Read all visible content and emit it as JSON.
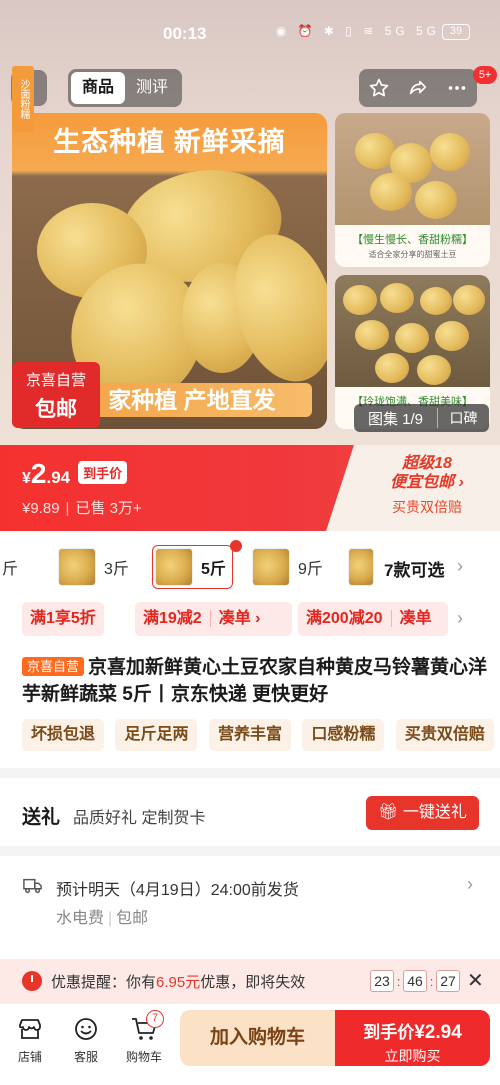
{
  "status_bar": {
    "time": "00:13",
    "icons": "◉ ⏰ ✱ ▯ ≋ 5G 5G",
    "battery": "39"
  },
  "top_nav": {
    "tabs": [
      {
        "label": "商品",
        "active": true
      },
      {
        "label": "测评",
        "active": false
      }
    ],
    "message_badge": "5+"
  },
  "gallery": {
    "main_headline": "生态种植 新鲜采摘",
    "side_tag": "沙面粉糯",
    "main_bottom_text": "家种植 产地直发",
    "jd_tag_line1": "京喜自营",
    "jd_tag_line2": "包邮",
    "thumb1_caption": "【慢生慢长、香甜粉糯】",
    "thumb1_sub": "适合全家分享的甜蜜土豆",
    "thumb2_caption": "【玲珑饱满、香甜美味】",
    "counter": "图集 1/9",
    "review_label": "口碑"
  },
  "price": {
    "currency": "¥",
    "integer": "2",
    "decimal": ".94",
    "label": "到手价",
    "original": "¥9.89",
    "sold": "已售 3万+",
    "promo_line1": "超级18",
    "promo_line2": "便宜包邮 ›",
    "promo_line3": "买贵双倍赔"
  },
  "sku": {
    "options": [
      {
        "label": "斤"
      },
      {
        "label": "3斤"
      },
      {
        "label": "5斤",
        "selected": true
      },
      {
        "label": "9斤"
      }
    ],
    "count_label": "7款可选"
  },
  "coupons": {
    "c1": "满1享5折",
    "c2": "满19减2",
    "c2_sub": "凑单 ›",
    "c3": "满200减20",
    "c3_sub": "凑单"
  },
  "product": {
    "badge": "京喜自营",
    "title": "京喜加新鲜黄心土豆农家自种黄皮马铃薯黄心洋芋新鲜蔬菜 5斤丨京东快递 更快更好",
    "tags": [
      "坏损包退",
      "足斤足两",
      "营养丰富",
      "口感粉糯",
      "买贵双倍赔"
    ]
  },
  "gift": {
    "title": "送礼",
    "subtitle": "品质好礼 定制贺卡",
    "button": "一键送礼"
  },
  "delivery": {
    "line1": "预计明天（4月19日）24:00前发货",
    "fee_label": "水电费",
    "shipping": "包邮"
  },
  "reminder": {
    "prefix": "优惠提醒：你有",
    "amount": "6.95元",
    "suffix": "优惠，即将失效",
    "hh": "23",
    "mm": "46",
    "ss": "27"
  },
  "bottom_bar": {
    "store": "店铺",
    "service": "客服",
    "cart": "购物车",
    "cart_count": "7",
    "add_to_cart": "加入购物车",
    "buy_price_label": "到手价",
    "buy_price": "¥2.94",
    "buy_now": "立即购买"
  },
  "colors": {
    "accent": "#e8352b",
    "promo_orange": "#f59b3d",
    "tag_bg": "#fbf1e6"
  }
}
